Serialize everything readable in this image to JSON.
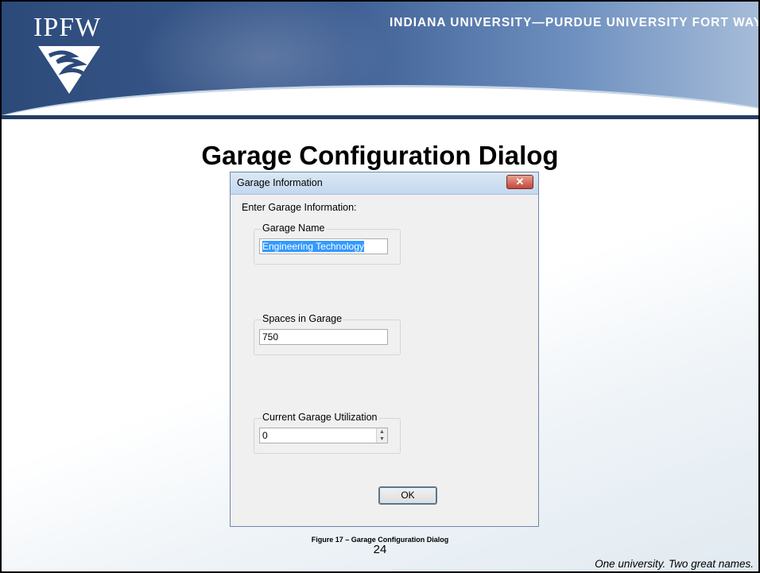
{
  "slide": {
    "logo_text": "IPFW",
    "university": "INDIANA UNIVERSITY—PURDUE UNIVERSITY FORT WAYNE",
    "title": "Garage Configuration Dialog",
    "caption": "Figure 17 – Garage Configuration Dialog",
    "page": "24",
    "tagline": "One university.  Two great names."
  },
  "dlg": {
    "title": "Garage Information",
    "close": "✕",
    "prompt": "Enter Garage Information:",
    "name": {
      "label": "Garage Name",
      "value": "Engineering Technology"
    },
    "spaces": {
      "label": "Spaces in Garage",
      "value": "750"
    },
    "util": {
      "label": "Current Garage Utilization",
      "value": "0"
    },
    "ok": "OK"
  }
}
